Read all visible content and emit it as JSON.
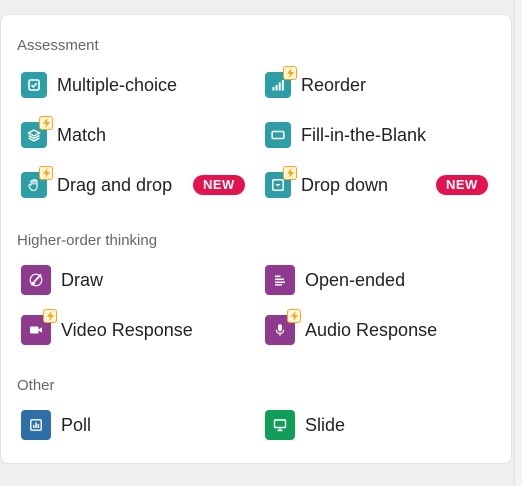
{
  "colors": {
    "teal": "#2d9da6",
    "purple": "#8e3b8f",
    "blue": "#2e6faa",
    "green": "#0f9d58",
    "badge": "#e3134f",
    "bolt": "#f2a91b"
  },
  "sections": {
    "assessment": {
      "title": "Assessment",
      "items": {
        "multiple_choice": {
          "label": "Multiple-choice",
          "icon": "checkbox-icon"
        },
        "reorder": {
          "label": "Reorder",
          "icon": "bar-chart-icon"
        },
        "match": {
          "label": "Match",
          "icon": "layers-icon"
        },
        "fill_blank": {
          "label": "Fill-in-the-Blank",
          "icon": "blank-box-icon"
        },
        "drag_drop": {
          "label": "Drag and drop",
          "icon": "hand-icon",
          "badge": "NEW"
        },
        "drop_down": {
          "label": "Drop down",
          "icon": "dropdown-icon",
          "badge": "NEW"
        }
      }
    },
    "higher_order": {
      "title": "Higher-order thinking",
      "items": {
        "draw": {
          "label": "Draw",
          "icon": "brush-icon"
        },
        "open_ended": {
          "label": "Open-ended",
          "icon": "text-lines-icon"
        },
        "video_response": {
          "label": "Video Response",
          "icon": "video-camera-icon"
        },
        "audio_response": {
          "label": "Audio Response",
          "icon": "microphone-icon"
        }
      }
    },
    "other": {
      "title": "Other",
      "items": {
        "poll": {
          "label": "Poll",
          "icon": "poll-icon"
        },
        "slide": {
          "label": "Slide",
          "icon": "presentation-icon"
        }
      }
    }
  }
}
